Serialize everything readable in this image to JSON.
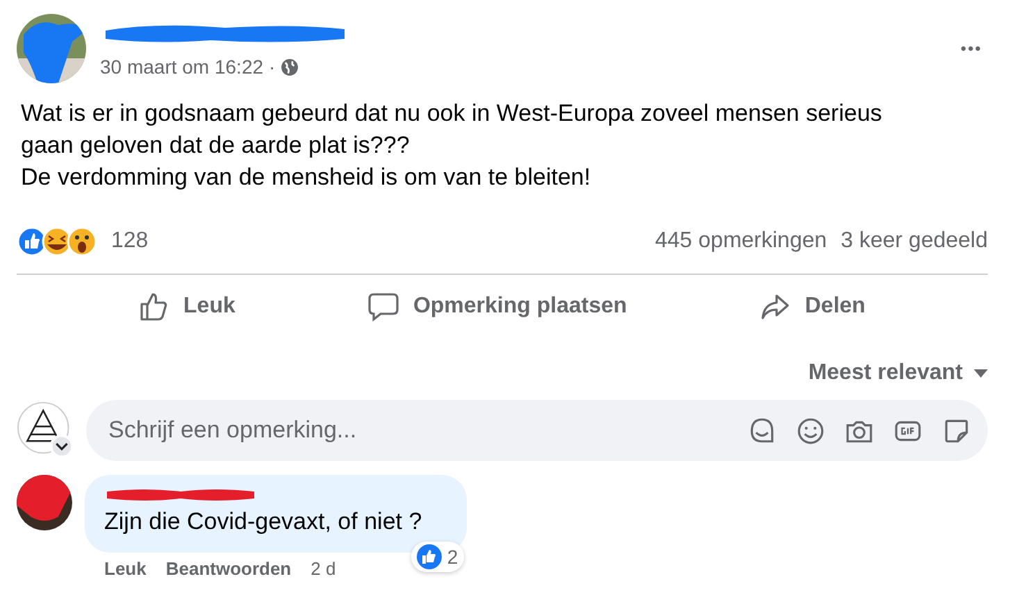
{
  "post": {
    "date": "30 maart om 16:22",
    "separator": "·",
    "more": "•••",
    "body": [
      "Wat is er in godsnaam gebeurd dat nu ook in West-Europa zoveel mensen serieus gaan geloven dat de aarde plat is???",
      "De verdomming van de mensheid is om van te bleiten!"
    ],
    "reaction_count": "128",
    "comments": "445 opmerkingen",
    "shares": "3 keer gedeeld"
  },
  "actions": [
    "Leuk",
    "Opmerking plaatsen",
    "Delen"
  ],
  "sort": "Meest relevant",
  "composer": {
    "placeholder": "Schrijf een opmerking..."
  },
  "comment": {
    "text": "Zijn die Covid-gevaxt, of niet ?",
    "likes": "2",
    "actions": [
      "Leuk",
      "Beantwoorden"
    ],
    "time": "2 d"
  }
}
